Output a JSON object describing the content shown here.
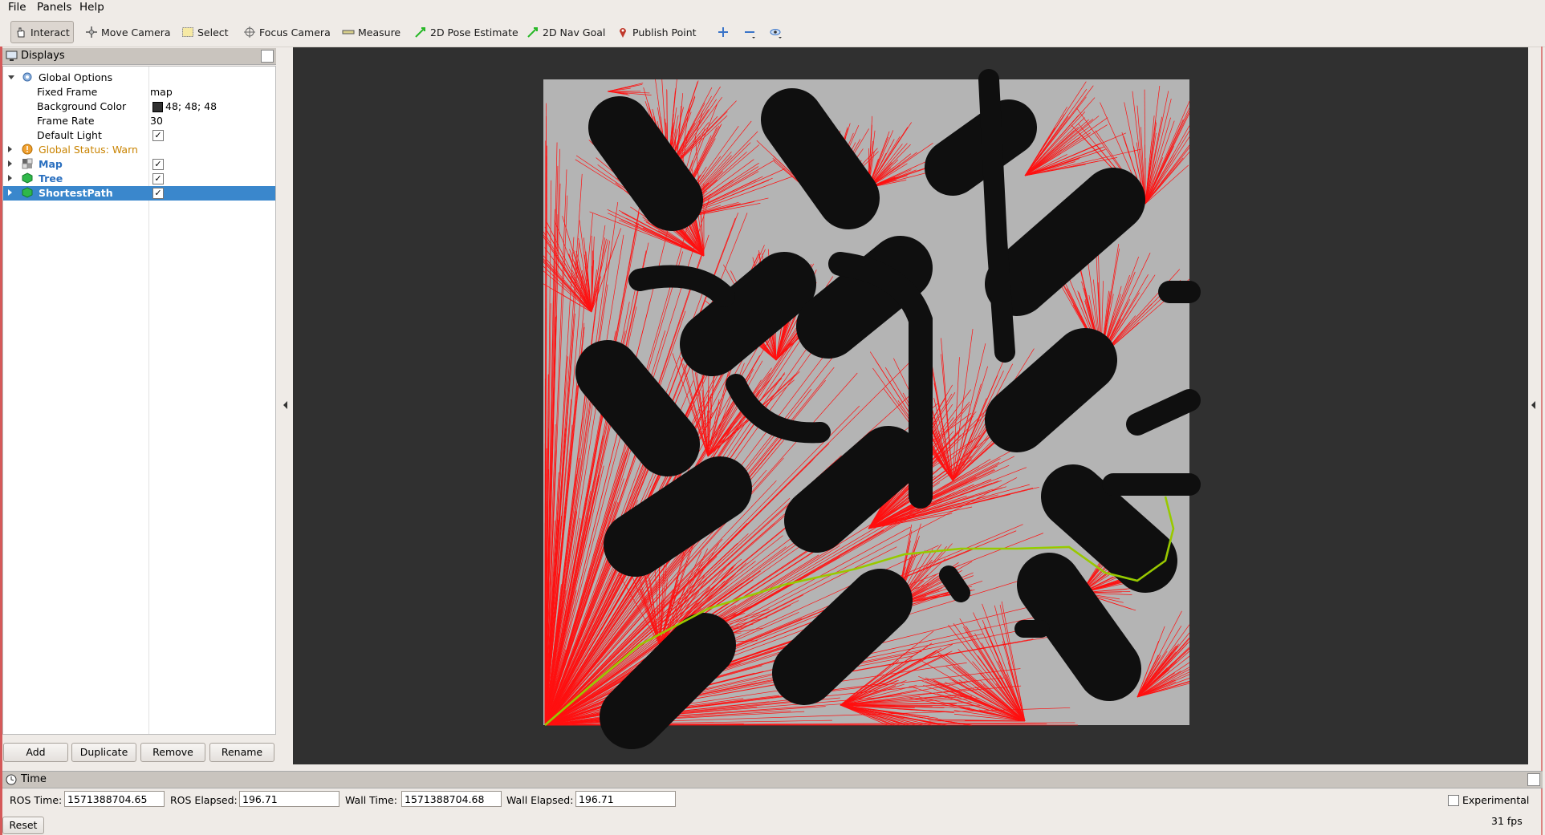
{
  "menu": {
    "file": "File",
    "panels": "Panels",
    "help": "Help"
  },
  "toolbar": {
    "interact": "Interact",
    "move_camera": "Move Camera",
    "select": "Select",
    "focus_camera": "Focus Camera",
    "measure": "Measure",
    "pose_estimate": "2D Pose Estimate",
    "nav_goal": "2D Nav Goal",
    "publish_point": "Publish Point"
  },
  "displays": {
    "title": "Displays",
    "global_options": "Global Options",
    "fixed_frame_label": "Fixed Frame",
    "fixed_frame_value": "map",
    "bg_color_label": "Background Color",
    "bg_color_value": "48; 48; 48",
    "frame_rate_label": "Frame Rate",
    "frame_rate_value": "30",
    "default_light_label": "Default Light",
    "global_status": "Global Status: Warn",
    "map": "Map",
    "tree": "Tree",
    "shortest_path": "ShortestPath",
    "buttons": {
      "add": "Add",
      "duplicate": "Duplicate",
      "remove": "Remove",
      "rename": "Rename"
    }
  },
  "time": {
    "title": "Time",
    "ros_time_label": "ROS Time:",
    "ros_time": "1571388704.65",
    "ros_elapsed_label": "ROS Elapsed:",
    "ros_elapsed": "196.71",
    "wall_time_label": "Wall Time:",
    "wall_time": "1571388704.68",
    "wall_elapsed_label": "Wall Elapsed:",
    "wall_elapsed": "196.71",
    "experimental": "Experimental",
    "fps": "31 fps",
    "reset": "Reset"
  },
  "colors": {
    "background": "#303030",
    "map_free": "#b4b4b4",
    "obstacle": "#0f0f0f",
    "tree_edges": "#ff0000",
    "path": "#7ee000",
    "selection": "#3a87cc",
    "warn": "#e08a00"
  }
}
